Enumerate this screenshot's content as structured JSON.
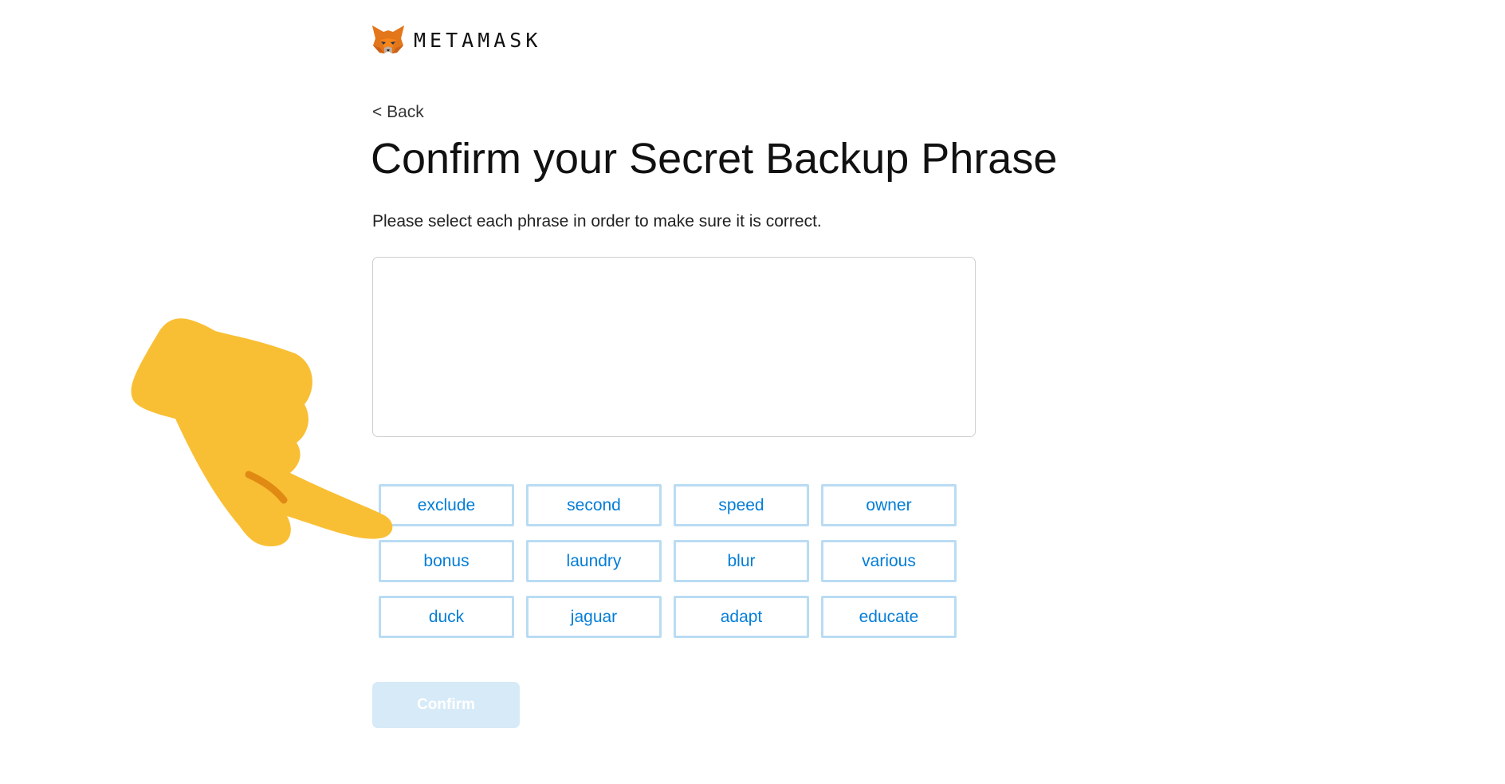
{
  "brand": {
    "name": "METAMASK",
    "logo_icon": "metamask-fox-icon"
  },
  "nav": {
    "back_label": "< Back"
  },
  "main": {
    "title": "Confirm your Secret Backup Phrase",
    "instructions": "Please select each phrase in order to make sure it is correct.",
    "selected_words": [],
    "words": [
      "exclude",
      "second",
      "speed",
      "owner",
      "bonus",
      "laundry",
      "blur",
      "various",
      "duck",
      "jaguar",
      "adapt",
      "educate"
    ],
    "confirm_label": "Confirm",
    "confirm_enabled": false
  },
  "overlay": {
    "pointer_icon": "pointing-hand-icon"
  },
  "colors": {
    "accent": "#037dd6",
    "word_border": "#b9dcf3",
    "confirm_disabled_bg": "#d7eaf8",
    "hand_yellow": "#f9bf34",
    "fox_orange": "#e2761b"
  }
}
